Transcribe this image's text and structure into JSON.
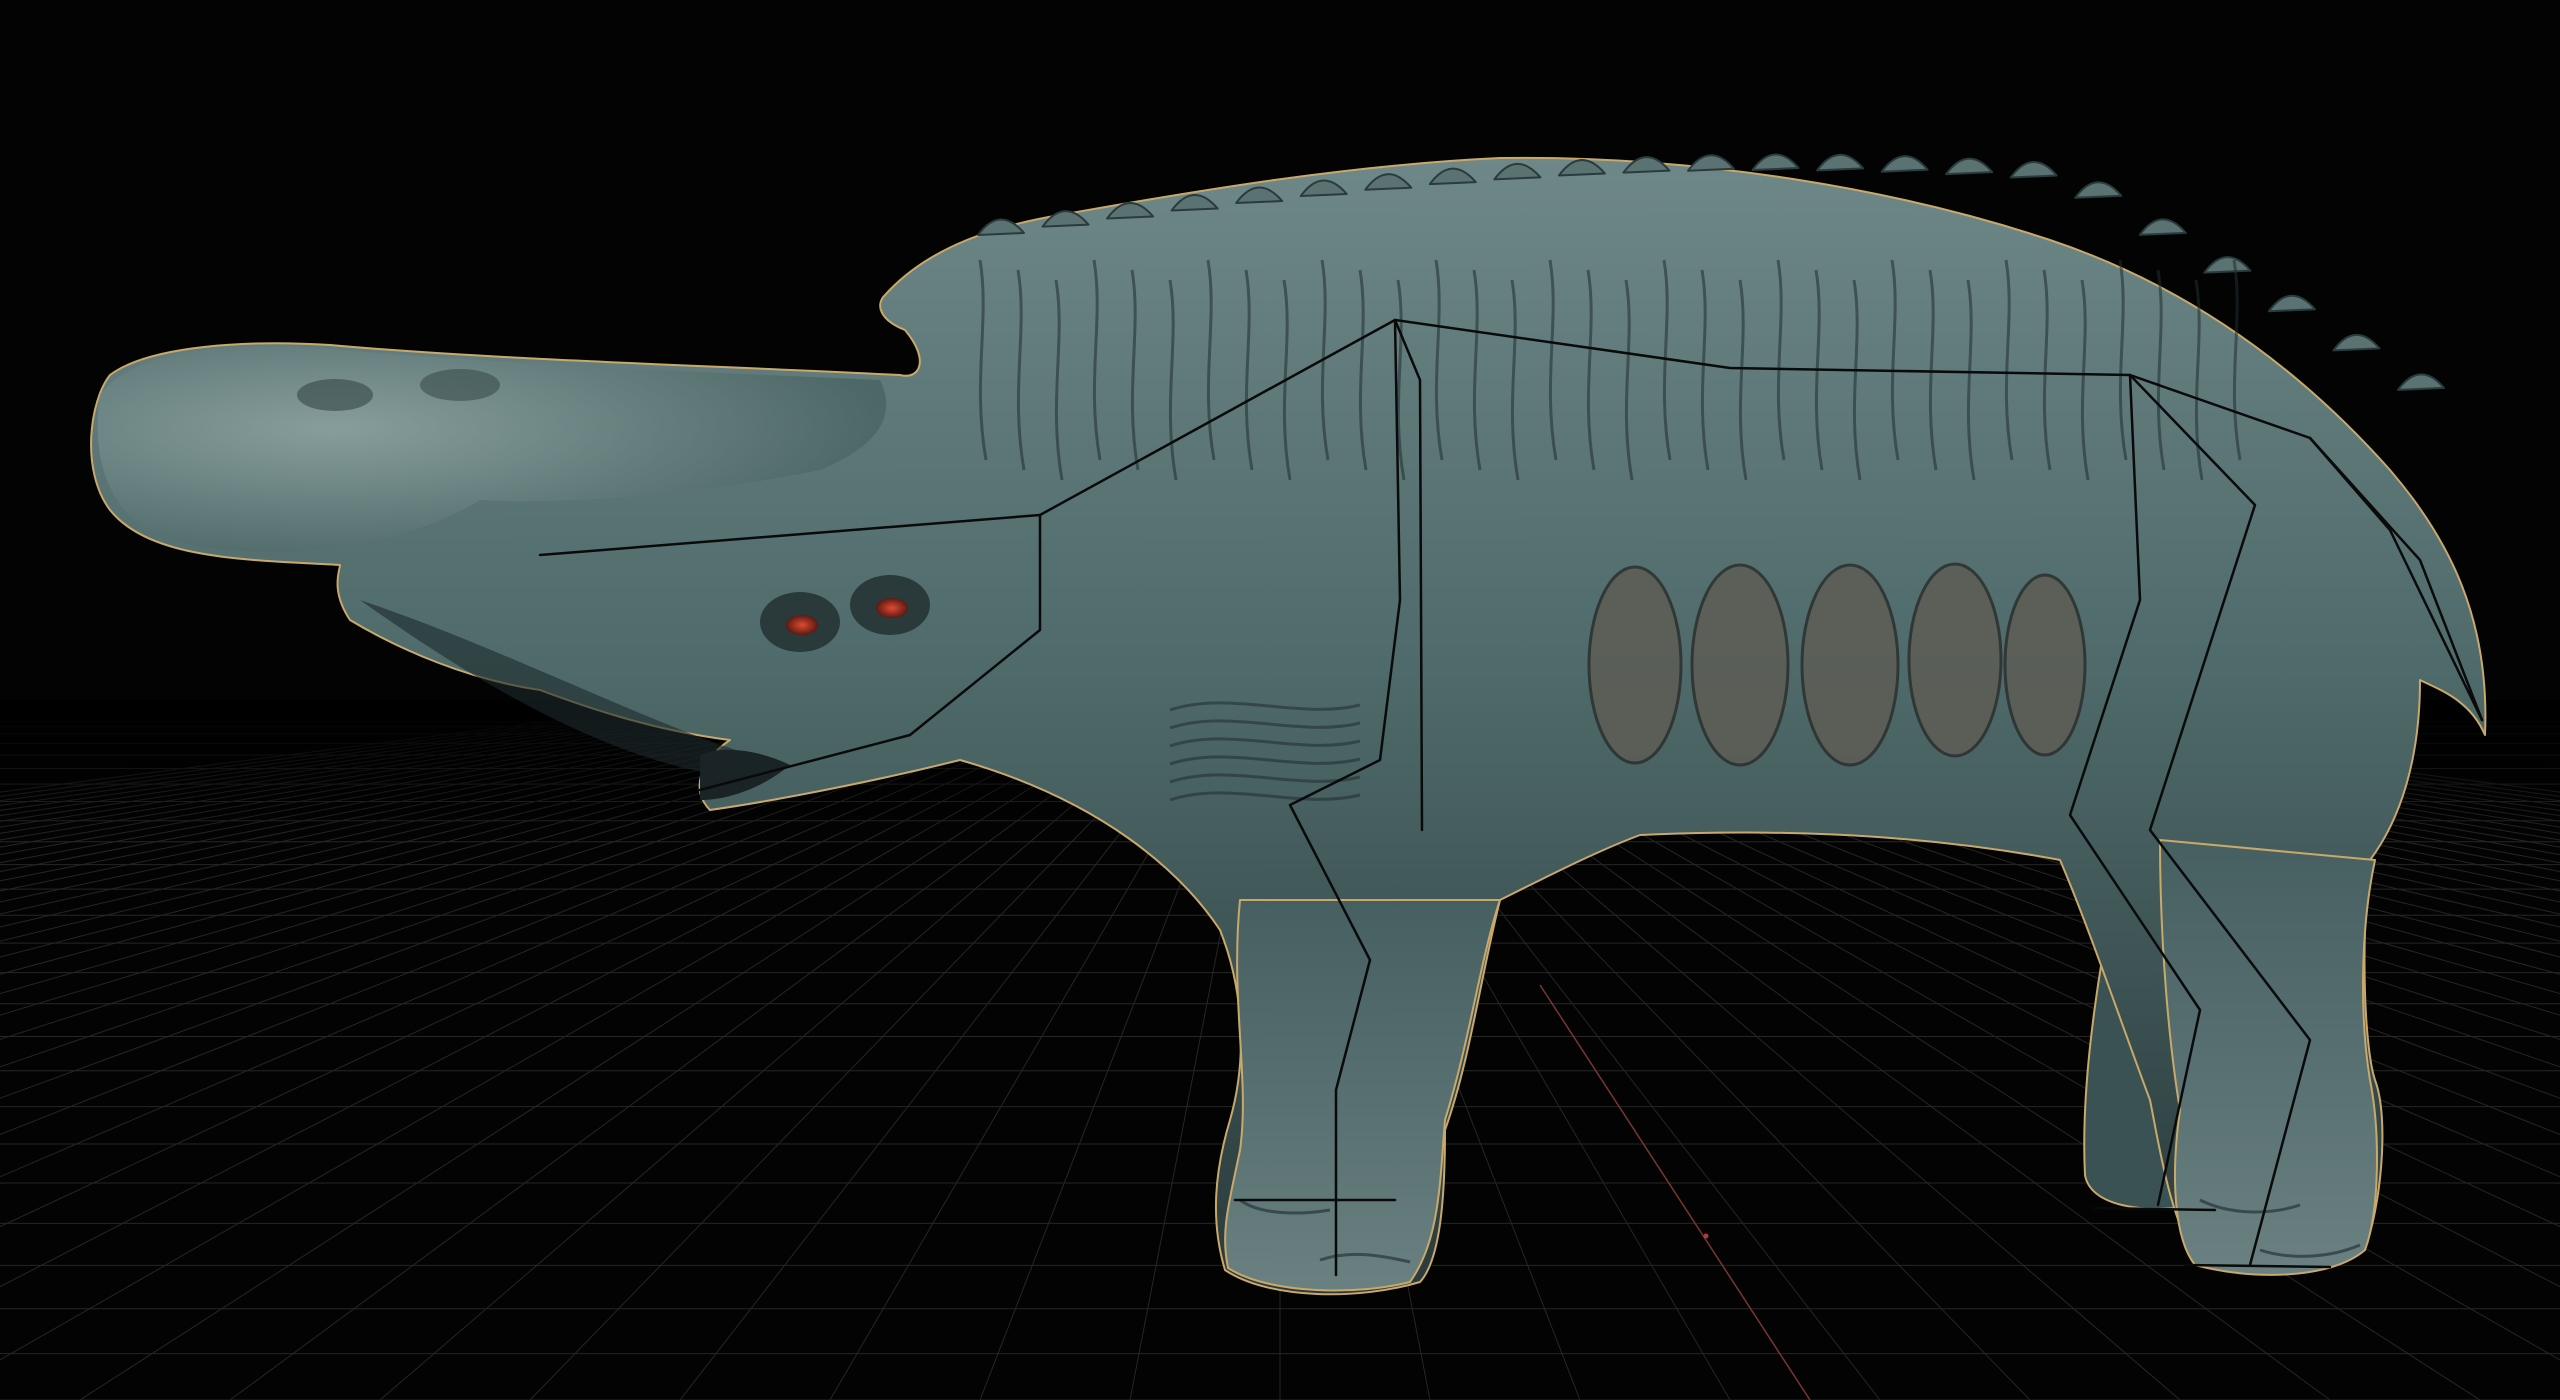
{
  "viewport": {
    "background": "#030303",
    "grid_color": "#262626",
    "axis_color": "#8a3a3a",
    "origin_color": "#b03a3a"
  },
  "model": {
    "skin_base": "#4f6a6a",
    "skin_dark": "#1e2c2f",
    "skin_light": "#89a2a0",
    "selection_outline": "#c9a96a",
    "rig_color": "#0a0a0a",
    "eye_color": "#c0362a"
  },
  "icons": [
    "grid-floor",
    "model-outline",
    "skeleton-rig"
  ]
}
